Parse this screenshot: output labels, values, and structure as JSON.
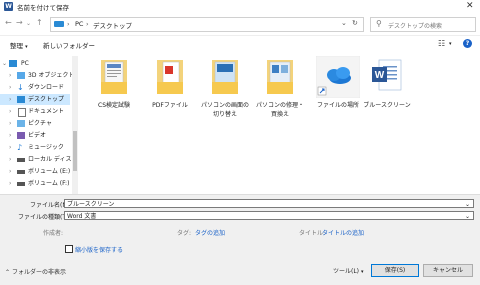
{
  "window": {
    "title": "名前を付けて保存",
    "app_icon": "W"
  },
  "address": {
    "path": [
      "PC",
      "デスクトップ"
    ],
    "search_placeholder": "デスクトップの検索"
  },
  "toolbar": {
    "organize": "整理",
    "new_folder": "新しいフォルダー"
  },
  "nav_items": [
    {
      "label": "PC",
      "icon": "pc-icon"
    },
    {
      "label": "3D オブジェクト",
      "icon": "cube-icon"
    },
    {
      "label": "ダウンロード",
      "icon": "download-icon"
    },
    {
      "label": "デスクトップ",
      "icon": "desktop-icon"
    },
    {
      "label": "ドキュメント",
      "icon": "document-icon"
    },
    {
      "label": "ピクチャ",
      "icon": "picture-icon"
    },
    {
      "label": "ビデオ",
      "icon": "video-icon"
    },
    {
      "label": "ミュージック",
      "icon": "music-icon"
    },
    {
      "label": "ローカル ディスク (C:)",
      "icon": "disk-icon"
    },
    {
      "label": "ボリューム (E:)",
      "icon": "drive-icon"
    },
    {
      "label": "ボリューム (F:)",
      "icon": "drive-icon"
    }
  ],
  "files": [
    {
      "name": "CS検定試験",
      "icon": "folder-icon"
    },
    {
      "name": "PDFファイル",
      "icon": "folder-icon"
    },
    {
      "name": "パソコンの画面の切り替え",
      "icon": "folder-icon"
    },
    {
      "name": "パソコンの修理・買換え",
      "icon": "folder-icon"
    },
    {
      "name": "ファイルの場所",
      "icon": "onedrive-shortcut-icon"
    },
    {
      "name": "ブルースクリーン",
      "icon": "word-document-icon"
    }
  ],
  "form": {
    "filename_label": "ファイル名(N):",
    "filename_value": "ブルースクリーン",
    "filetype_label": "ファイルの種類(T):",
    "filetype_value": "Word 文書",
    "author_label": "作成者:",
    "tags_label": "タグ:",
    "tags_value": "タグの追加",
    "title_label": "タイトル:",
    "title_value": "タイトルの追加",
    "thumbnail_label": "縮小版を保存する",
    "thumbnail_checked": false
  },
  "footer": {
    "hide_folders": "フォルダーの非表示",
    "tools": "ツール(L)",
    "save": "保存(S)",
    "cancel": "キャンセル"
  }
}
